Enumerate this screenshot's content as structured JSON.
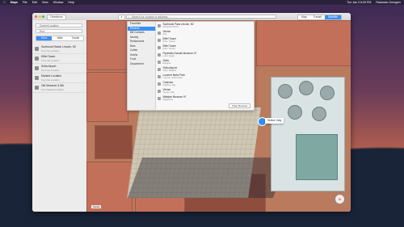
{
  "menubar": {
    "apple": "",
    "items": [
      "Maps",
      "File",
      "Edit",
      "View",
      "Window",
      "Help"
    ],
    "clock": "Tue Jan 3  6:09 PM",
    "user": "Radoslav Georgiev"
  },
  "window": {
    "title": "Directions",
    "search_placeholder": "Search for a place or address",
    "view_modes": [
      {
        "label": "Map",
        "active": false
      },
      {
        "label": "Transit",
        "active": false
      },
      {
        "label": "Satellite",
        "active": true
      }
    ]
  },
  "sidebar": {
    "from_value": "Current Location",
    "to_value": "End",
    "modes": [
      {
        "label": "Drive",
        "active": true
      },
      {
        "label": "Walk",
        "active": false
      },
      {
        "label": "Transit",
        "active": false
      }
    ],
    "recents": [
      {
        "title": "Sunbrook Ranch Lincoln, 50",
        "subtitle": "From the Location"
      },
      {
        "title": "Eiffel Tower",
        "subtitle": "From the Location"
      },
      {
        "title": "Sofia Airport",
        "subtitle": "From the Location"
      },
      {
        "title": "Marked Location",
        "subtitle": "From the Location"
      },
      {
        "title": "Old Museum & 5th",
        "subtitle": "From Marked Location"
      }
    ]
  },
  "dropdown": {
    "categories": [
      {
        "label": "Favorites",
        "active": false
      },
      {
        "label": "Recents",
        "active": true
      },
      {
        "label": "Bill Contacts",
        "active": false
      },
      {
        "label": "Nearby",
        "active": false
      },
      {
        "label": "Restaurants",
        "active": false
      },
      {
        "label": "Bars",
        "active": false
      },
      {
        "label": "Coffee",
        "active": false
      },
      {
        "label": "Hotels",
        "active": false
      },
      {
        "label": "Food",
        "active": false
      },
      {
        "label": "Department",
        "active": false
      }
    ],
    "items": [
      {
        "title": "Sunbrook Pass Lincoln, 50",
        "subtitle": "Sunbrook Ranch"
      },
      {
        "title": "Venice",
        "subtitle": "Italy"
      },
      {
        "title": "Eiffel Tower",
        "subtitle": "Paris, France"
      },
      {
        "title": "Eiffel Tower",
        "subtitle": "Paris, France"
      },
      {
        "title": "Pyramids Karnak Museum 07",
        "subtitle": "Luxor, Egypt"
      },
      {
        "title": "Sofia",
        "subtitle": "Bulgaria"
      },
      {
        "title": "Sofia Airport",
        "subtitle": "Sofia, Bulgaria"
      },
      {
        "title": "Lucerne Bahn Park",
        "subtitle": "Lucerne, Switzerland"
      },
      {
        "title": "Cosenza",
        "subtitle": "Calabria, Italy"
      },
      {
        "title": "Venice",
        "subtitle": "Veneto, Italy"
      },
      {
        "title": "Walstan Museum 97",
        "subtitle": "Suggested"
      }
    ],
    "clear_label": "Clear Recents"
  },
  "map": {
    "callout_label": "Venice, Italy",
    "compass_label": "N",
    "scale_label": "Venice"
  },
  "colors": {
    "accent": "#3b8ef3",
    "pin": "#2f8ef5"
  }
}
